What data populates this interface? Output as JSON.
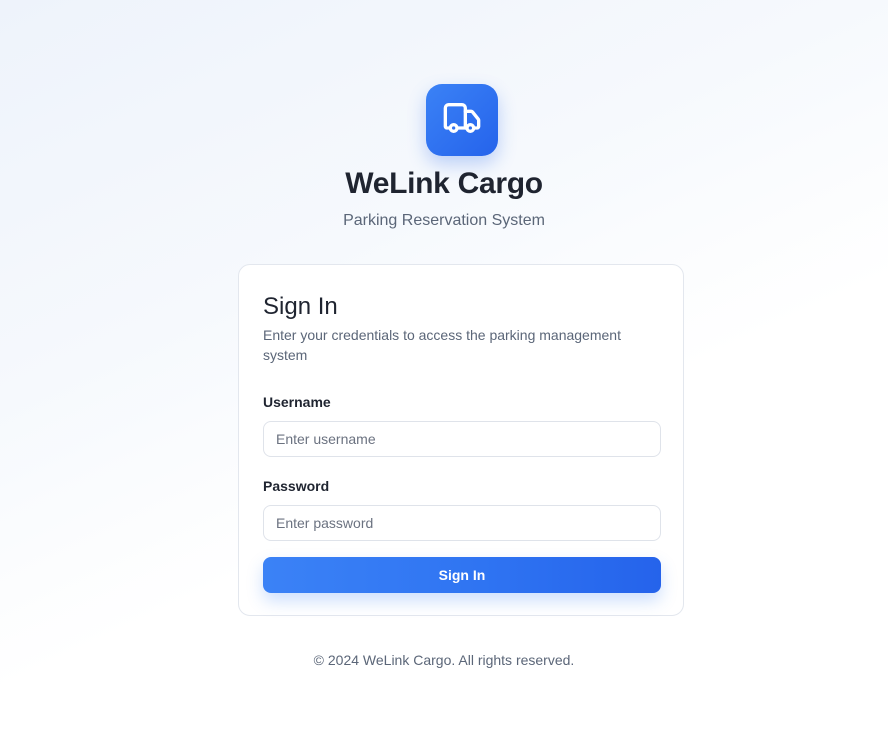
{
  "brand": {
    "title": "WeLink Cargo",
    "subtitle": "Parking Reservation System",
    "logo_icon": "truck-icon",
    "accent_color": "#2563eb"
  },
  "login_card": {
    "title": "Sign In",
    "description": "Enter your credentials to access the parking management system",
    "username": {
      "label": "Username",
      "placeholder": "Enter username",
      "value": ""
    },
    "password": {
      "label": "Password",
      "placeholder": "Enter password",
      "value": ""
    },
    "submit_label": "Sign In"
  },
  "footer": {
    "text": "© 2024 WeLink Cargo. All rights reserved."
  }
}
